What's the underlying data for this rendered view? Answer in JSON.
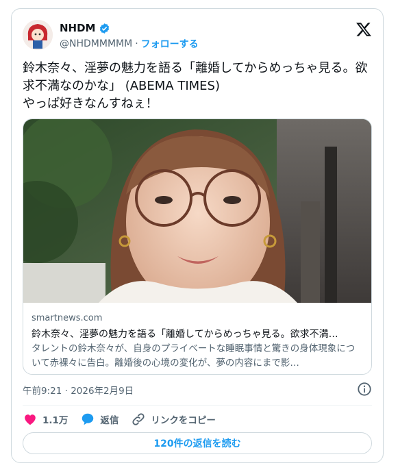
{
  "author": {
    "name": "NHDM",
    "handle": "@NHDMMMMM",
    "separator": "·",
    "follow_label": "フォローする"
  },
  "tweet": {
    "text": "鈴木奈々、淫夢の魅力を語る「離婚してからめっちゃ見る。欲求不満なのかな」 (ABEMA TIMES)\nやっぱ好きなんすねぇ！"
  },
  "link_card": {
    "domain": "smartnews.com",
    "title": "鈴木奈々、淫夢の魅力を語る「離婚してからめっちゃ見る。欲求不満…",
    "description": "タレントの鈴木奈々が、自身のプライベートな睡眠事情と驚きの身体現象について赤裸々に告白。離婚後の心境の変化が、夢の内容にまで影…"
  },
  "meta": {
    "timestamp": "午前9:21 · 2026年2月9日"
  },
  "actions": {
    "like_count": "1.1万",
    "reply_label": "返信",
    "copy_link_label": "リンクをコピー"
  },
  "replies_button": "120件の返信を読む",
  "colors": {
    "accent": "#1d9bf0",
    "like": "#f91880",
    "text": "#0f1419",
    "secondary": "#536471"
  }
}
